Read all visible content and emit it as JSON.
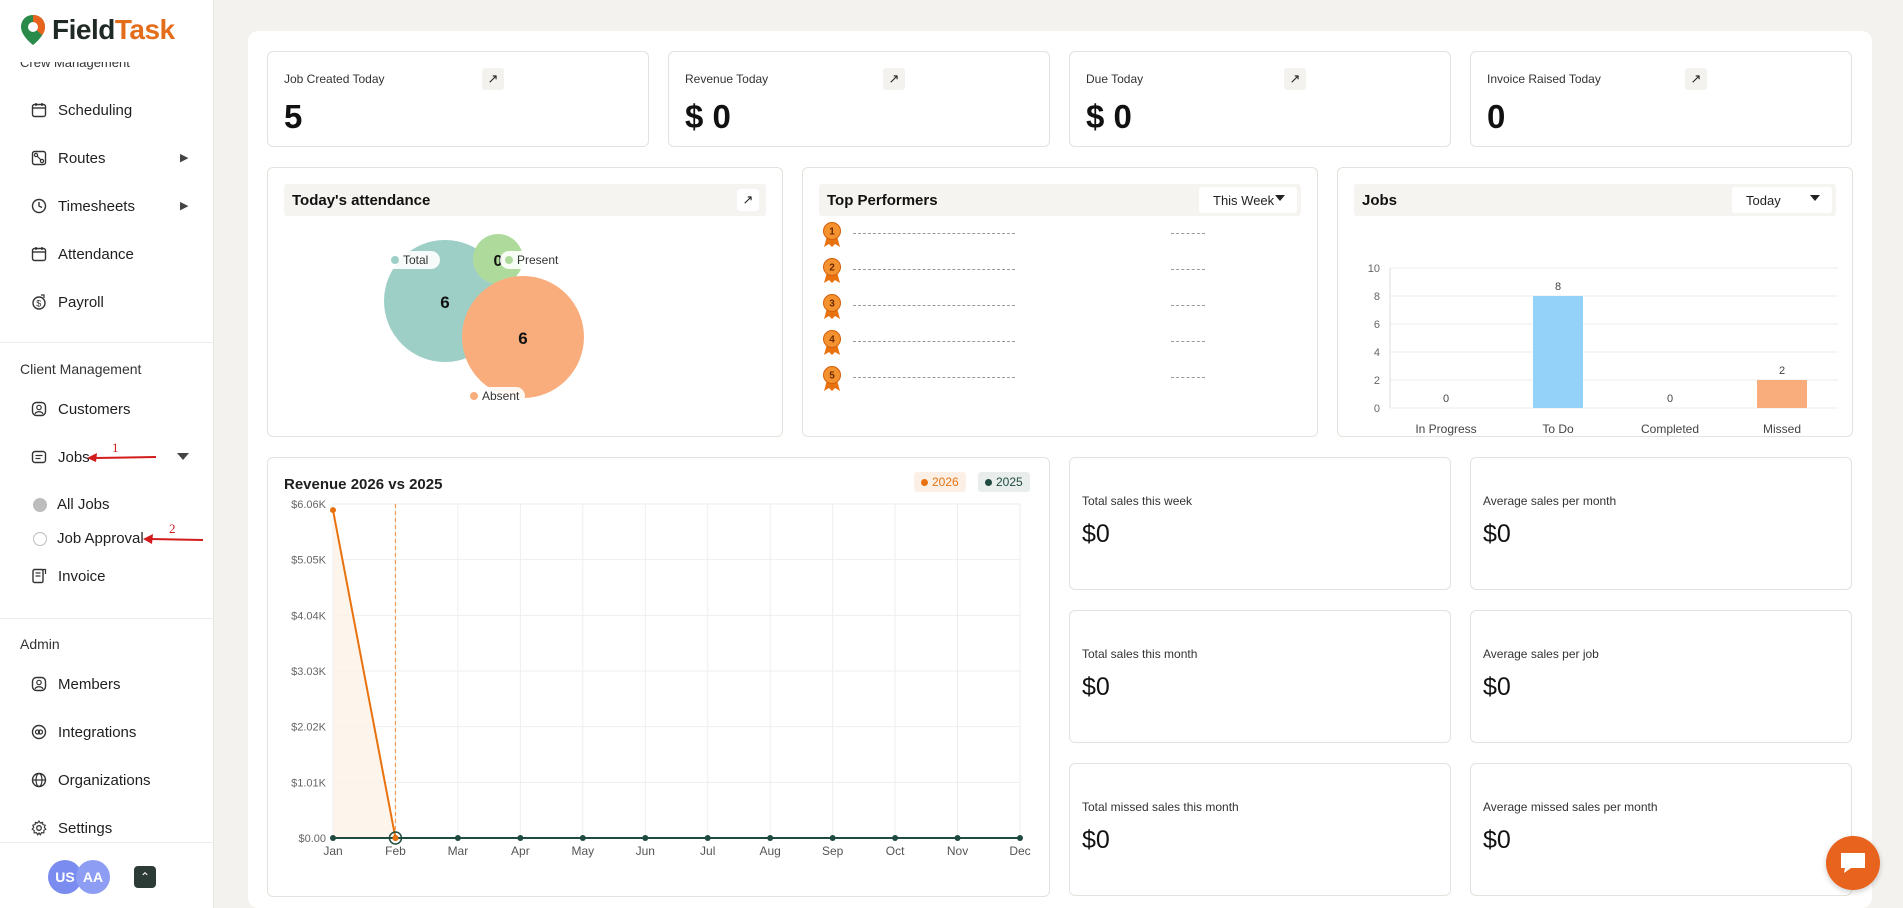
{
  "brand": {
    "name_part1": "Field",
    "name_part2": "Task"
  },
  "sidebar": {
    "cut_section": "Crew Management",
    "crew_items": [
      {
        "label": "Scheduling",
        "icon": "calendar-icon"
      },
      {
        "label": "Routes",
        "icon": "route-icon",
        "caret": "right"
      },
      {
        "label": "Timesheets",
        "icon": "clock-icon",
        "caret": "right"
      },
      {
        "label": "Attendance",
        "icon": "calendar-check-icon"
      },
      {
        "label": "Payroll",
        "icon": "payroll-icon"
      }
    ],
    "client_section": "Client Management",
    "client_items": [
      {
        "label": "Customers",
        "icon": "user-circle-icon"
      },
      {
        "label": "Jobs",
        "icon": "jobs-icon",
        "caret": "down"
      }
    ],
    "jobs_subitems": [
      {
        "label": "All Jobs"
      },
      {
        "label": "Job Approval"
      }
    ],
    "invoice_label": "Invoice",
    "admin_section": "Admin",
    "admin_items": [
      {
        "label": "Members",
        "icon": "members-icon"
      },
      {
        "label": "Integrations",
        "icon": "integrations-icon"
      },
      {
        "label": "Organizations",
        "icon": "organizations-icon"
      },
      {
        "label": "Settings",
        "icon": "gear-icon"
      }
    ],
    "annotations": [
      "1",
      "2"
    ],
    "avatars": [
      {
        "initials": "US",
        "color": "#7a8cf0"
      },
      {
        "initials": "AA",
        "color": "#8d9df3"
      }
    ]
  },
  "stats": [
    {
      "label": "Job Created Today",
      "value": "5"
    },
    {
      "label": "Revenue Today",
      "value": "$ 0"
    },
    {
      "label": "Due Today",
      "value": "$ 0"
    },
    {
      "label": "Invoice Raised Today",
      "value": "0"
    }
  ],
  "attendance": {
    "title": "Today's attendance",
    "legend": [
      "Total",
      "Present",
      "Absent"
    ],
    "values": {
      "total": "6",
      "present": "0",
      "absent": "6"
    },
    "colors": {
      "total": "#9ecfc6",
      "present": "#aedb9c",
      "absent": "#f9ad7c"
    }
  },
  "top_performers": {
    "title": "Top Performers",
    "period": "This Week",
    "ranks": [
      "1",
      "2",
      "3",
      "4",
      "5"
    ]
  },
  "jobs_chart": {
    "title": "Jobs",
    "period": "Today"
  },
  "revenue_chart": {
    "title": "Revenue 2026 vs 2025",
    "legend": [
      "2026",
      "2025"
    ]
  },
  "sales": [
    {
      "label": "Total sales this week",
      "value": "$0"
    },
    {
      "label": "Average sales per month",
      "value": "$0"
    },
    {
      "label": "Total sales this month",
      "value": "$0"
    },
    {
      "label": "Average sales per job",
      "value": "$0"
    },
    {
      "label": "Total missed sales this month",
      "value": "$0"
    },
    {
      "label": "Average missed sales per month",
      "value": "$0"
    }
  ],
  "chart_data": [
    {
      "type": "bar",
      "title": "Jobs",
      "categories": [
        "In Progress",
        "To Do",
        "Completed",
        "Missed"
      ],
      "values": [
        0,
        8,
        0,
        2
      ],
      "colors": [
        "#94d2fa",
        "#94d2fa",
        "#94d2fa",
        "#f9ad7c"
      ],
      "ylim": [
        0,
        10
      ],
      "yticks": [
        0,
        2,
        4,
        6,
        8,
        10
      ],
      "grid": true
    },
    {
      "type": "line",
      "title": "Revenue 2026 vs 2025",
      "categories": [
        "Jan",
        "Feb",
        "Mar",
        "Apr",
        "May",
        "Jun",
        "Jul",
        "Aug",
        "Sep",
        "Oct",
        "Nov",
        "Dec"
      ],
      "ytick_labels": [
        "$0.00",
        "$1.01K",
        "$2.02K",
        "$3.03K",
        "$4.04K",
        "$5.05K",
        "$6.06K"
      ],
      "ylim": [
        0,
        6060
      ],
      "series": [
        {
          "name": "2026",
          "color": "#e8720f",
          "values": [
            5950,
            0,
            null,
            null,
            null,
            null,
            null,
            null,
            null,
            null,
            null,
            null
          ]
        },
        {
          "name": "2025",
          "color": "#1e4a40",
          "values": [
            0,
            0,
            0,
            0,
            0,
            0,
            0,
            0,
            0,
            0,
            0,
            0
          ]
        }
      ],
      "legend_position": "top-right",
      "grid": true
    }
  ]
}
